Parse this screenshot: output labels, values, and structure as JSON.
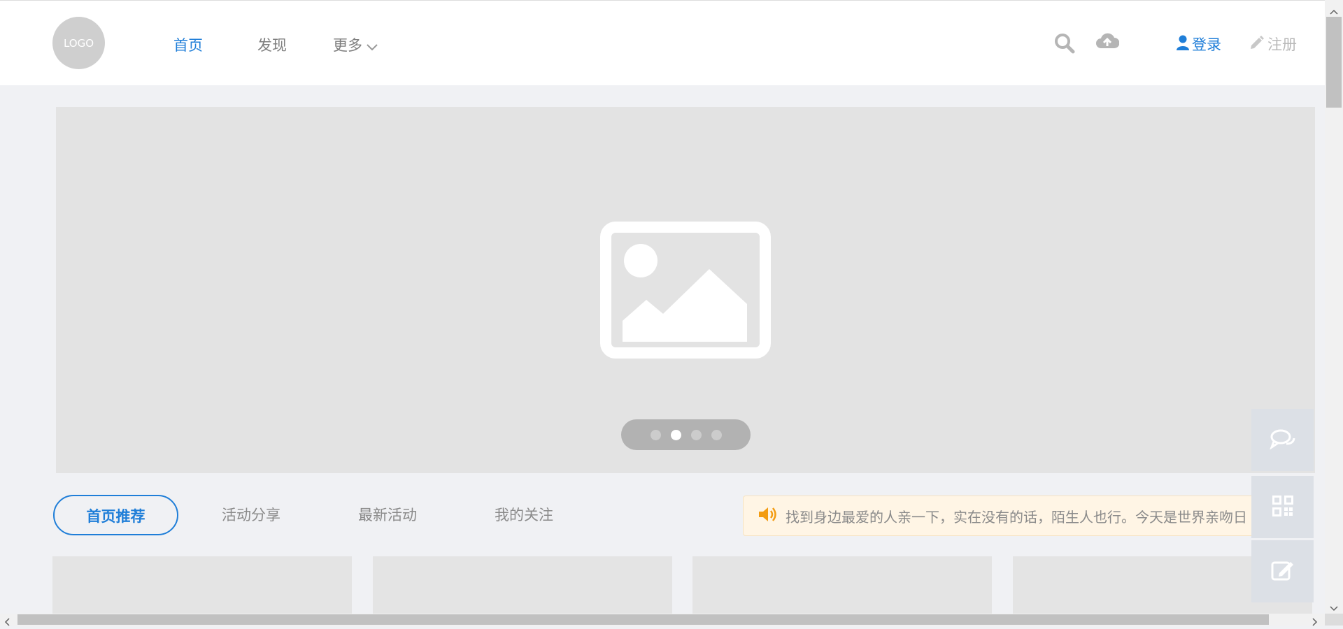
{
  "header": {
    "logo_text": "LOGO",
    "nav": [
      {
        "label": "首页",
        "active": true
      },
      {
        "label": "发现",
        "active": false
      },
      {
        "label": "更多",
        "active": false
      }
    ],
    "login_label": "登录",
    "register_label": "注册",
    "icons": [
      "search-icon",
      "cloud-upload-icon",
      "user-icon",
      "pencil-icon"
    ]
  },
  "banner": {
    "image_icon": "image-placeholder-icon",
    "slide_count": 4,
    "active_slide": 2
  },
  "tabs": [
    {
      "label": "首页推荐",
      "active": true
    },
    {
      "label": "活动分享",
      "active": false
    },
    {
      "label": "最新活动",
      "active": false
    },
    {
      "label": "我的关注",
      "active": false
    }
  ],
  "notice": {
    "icon": "speaker-icon",
    "text": "找到身边最爱的人亲一下，实在没有的话，陌生人也行。今天是世界亲吻日"
  },
  "side_tools": [
    "chat-icon",
    "qrcode-icon",
    "edit-icon"
  ],
  "colors": {
    "accent": "#1f7ed8",
    "notice_bg": "#fff5e5",
    "speaker": "#f39c12"
  }
}
